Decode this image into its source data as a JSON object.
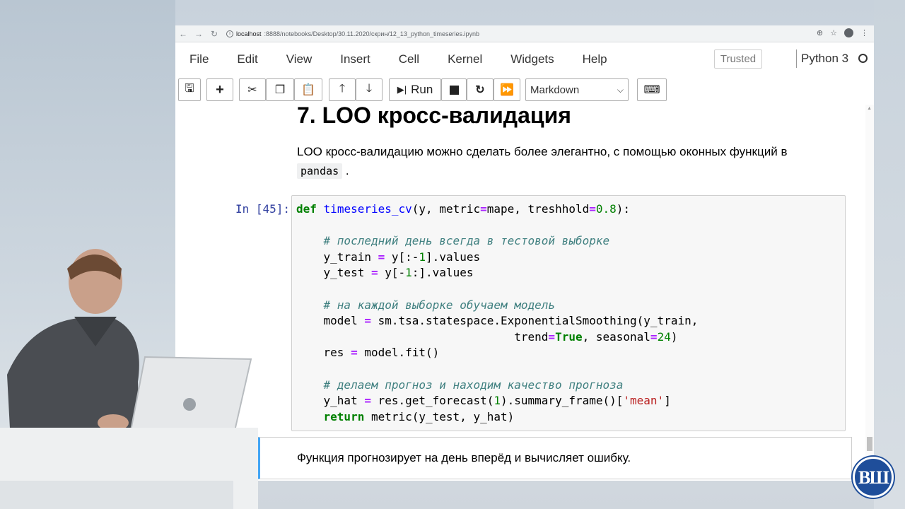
{
  "browser": {
    "url_host": "localhost",
    "url_path": ":8888/notebooks/Desktop/30.11.2020/скрин/12_13_python_timeseries.ipynb"
  },
  "menubar": {
    "items": [
      "File",
      "Edit",
      "View",
      "Insert",
      "Cell",
      "Kernel",
      "Widgets",
      "Help"
    ],
    "trusted": "Trusted",
    "kernel": "Python 3"
  },
  "toolbar": {
    "run_label": "Run",
    "cell_type": "Markdown"
  },
  "notebook": {
    "heading": "7. LOO кросс-валидация",
    "paragraph_before": "LOO кросс-валидацию можно сделать более элегантно, с помощью оконных функций в",
    "paragraph_code": "pandas",
    "paragraph_after": ".",
    "prompt": "In [45]:",
    "code_lines": [
      "def timeseries_cv(y, metric=mape, treshhold=0.8):",
      "",
      "    # последний день всегда в тестовой выборке",
      "    y_train = y[:-1].values",
      "    y_test = y[-1:].values",
      "",
      "    # на каждой выборке обучаем модель",
      "    model = sm.tsa.statespace.ExponentialSmoothing(y_train,",
      "                                trend=True, seasonal=24)",
      "    res = model.fit()",
      "",
      "    # делаем прогноз и находим качество прогноза",
      "    y_hat = res.get_forecast(1).summary_frame()['mean']",
      "    return metric(y_test, y_hat)"
    ],
    "next_cell_text": "Функция прогнозирует на день вперёд и вычисляет ошибку."
  },
  "colors": {
    "prompt": "#303f9f",
    "keyword": "#008000",
    "comment": "#408080",
    "selected_border": "#42a5f5",
    "logo": "#1f4e9a"
  },
  "icons": [
    "back-icon",
    "forward-icon",
    "reload-icon",
    "info-icon",
    "zoom-icon",
    "star-icon",
    "account-icon",
    "more-icon",
    "save-icon",
    "plus-icon",
    "cut-icon",
    "copy-icon",
    "paste-icon",
    "arrow-up-icon",
    "arrow-down-icon",
    "run-icon",
    "stop-icon",
    "restart-icon",
    "fast-forward-icon",
    "keyboard-icon",
    "hse-logo"
  ]
}
